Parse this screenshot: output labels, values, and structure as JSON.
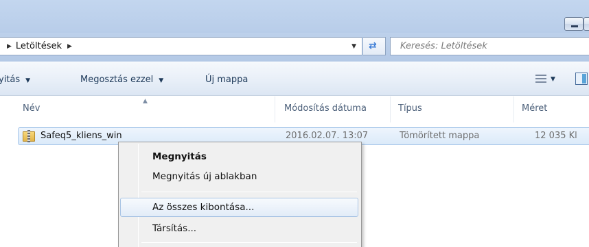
{
  "window": {
    "minimize_icon": "minimize-icon",
    "maximize_icon": "maximize-icon"
  },
  "address_bar": {
    "breadcrumb_separator_icon": "chevron-right-icon",
    "folder": "Letöltések",
    "dropdown_icon": "chevron-down-icon",
    "refresh_icon": "refresh-icon"
  },
  "search": {
    "placeholder": "Keresés: Letöltések"
  },
  "toolbar": {
    "open_label": "yitás",
    "share_label": "Megosztás ezzel",
    "new_folder_label": "Új mappa",
    "view_icon": "view-list-icon",
    "preview_pane_icon": "preview-pane-icon"
  },
  "columns": {
    "name": "Név",
    "modified": "Módosítás dátuma",
    "type": "Típus",
    "size": "Méret"
  },
  "files": [
    {
      "icon": "zip-folder-icon",
      "name": "Safeq5_kliens_win",
      "modified": "2016.02.07. 13:07",
      "type": "Tömörített mappa",
      "size": "12 035 Kl"
    }
  ],
  "context_menu": {
    "items": [
      {
        "label": "Megnyitás",
        "default": true
      },
      {
        "label": "Megnyitás új ablakban"
      },
      {
        "label": "Az összes kibontása...",
        "highlighted": true
      },
      {
        "label": "Társítás..."
      }
    ]
  },
  "colors": {
    "chrome_blue": "#b8cde9",
    "selection_border": "#a8c7ea",
    "menu_background": "#f0f0f0"
  }
}
